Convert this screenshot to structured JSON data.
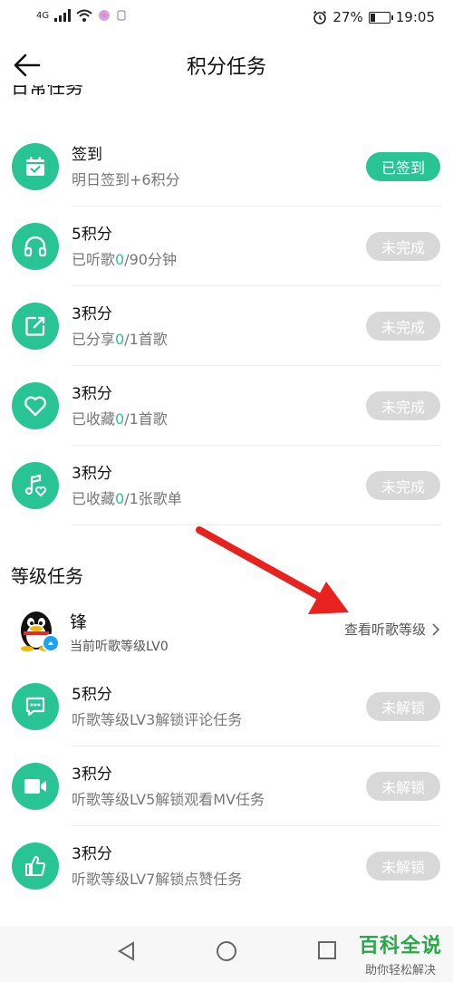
{
  "status_bar": {
    "signal_text": "4G",
    "battery": "27%",
    "battery_level": 0.27,
    "time": "19:05"
  },
  "header": {
    "title": "积分任务"
  },
  "daily": {
    "title": "日常任务",
    "tasks": [
      {
        "icon": "calendar-check-icon",
        "title": "签到",
        "sub_pre": "明日签到+6积分",
        "sub_hl": "",
        "sub_post": "",
        "button": "已签到",
        "done": true
      },
      {
        "icon": "headphones-icon",
        "title": "5积分",
        "sub_pre": "已听歌",
        "sub_hl": "0",
        "sub_post": "/90分钟",
        "button": "未完成",
        "done": false
      },
      {
        "icon": "share-icon",
        "title": "3积分",
        "sub_pre": "已分享",
        "sub_hl": "0",
        "sub_post": "/1首歌",
        "button": "未完成",
        "done": false
      },
      {
        "icon": "heart-icon",
        "title": "3积分",
        "sub_pre": "已收藏",
        "sub_hl": "0",
        "sub_post": "/1首歌",
        "button": "未完成",
        "done": false
      },
      {
        "icon": "music-heart-icon",
        "title": "3积分",
        "sub_pre": "已收藏",
        "sub_hl": "0",
        "sub_post": "/1张歌单",
        "button": "未完成",
        "done": false
      }
    ]
  },
  "level": {
    "title": "等级任务",
    "profile": {
      "name": "锋",
      "level_text": "当前听歌等级LV0",
      "link": "查看听歌等级"
    },
    "tasks": [
      {
        "icon": "comment-icon",
        "title": "5积分",
        "sub": "听歌等级LV3解锁评论任务",
        "button": "未解锁"
      },
      {
        "icon": "video-icon",
        "title": "3积分",
        "sub": "听歌等级LV5解锁观看MV任务",
        "button": "未解锁"
      },
      {
        "icon": "thumbs-up-icon",
        "title": "3积分",
        "sub": "听歌等级LV7解锁点赞任务",
        "button": "未解锁"
      }
    ]
  },
  "watermark": {
    "line1": "百科全说",
    "line2": "助你轻松解决"
  },
  "colors": {
    "accent": "#28c496",
    "disabled": "#d8d8d8",
    "annotation": "#e8231f"
  }
}
